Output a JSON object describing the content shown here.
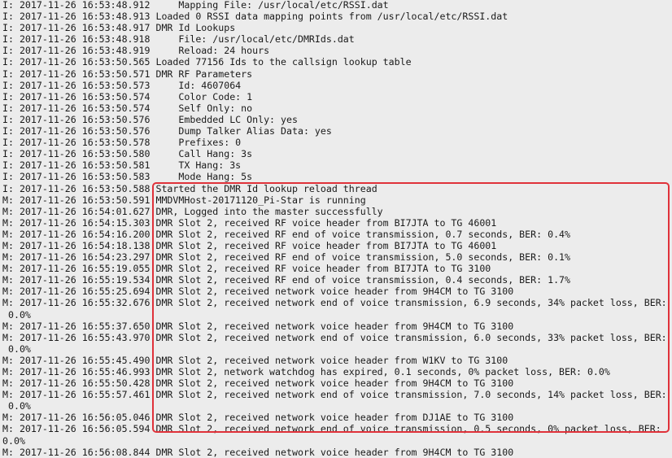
{
  "log_lines": [
    "I: 2017-11-26 16:53:48.912     Mapping File: /usr/local/etc/RSSI.dat",
    "I: 2017-11-26 16:53:48.913 Loaded 0 RSSI data mapping points from /usr/local/etc/RSSI.dat",
    "I: 2017-11-26 16:53:48.917 DMR Id Lookups",
    "I: 2017-11-26 16:53:48.918     File: /usr/local/etc/DMRIds.dat",
    "I: 2017-11-26 16:53:48.919     Reload: 24 hours",
    "I: 2017-11-26 16:53:50.565 Loaded 77156 Ids to the callsign lookup table",
    "I: 2017-11-26 16:53:50.571 DMR RF Parameters",
    "I: 2017-11-26 16:53:50.573     Id: 4607064",
    "I: 2017-11-26 16:53:50.574     Color Code: 1",
    "I: 2017-11-26 16:53:50.574     Self Only: no",
    "I: 2017-11-26 16:53:50.576     Embedded LC Only: yes",
    "I: 2017-11-26 16:53:50.576     Dump Talker Alias Data: yes",
    "I: 2017-11-26 16:53:50.578     Prefixes: 0",
    "I: 2017-11-26 16:53:50.580     Call Hang: 3s",
    "I: 2017-11-26 16:53:50.581     TX Hang: 3s",
    "I: 2017-11-26 16:53:50.583     Mode Hang: 5s",
    "I: 2017-11-26 16:53:50.588 Started the DMR Id lookup reload thread",
    "M: 2017-11-26 16:53:50.591 MMDVMHost-20171120_Pi-Star is running",
    "M: 2017-11-26 16:54:01.627 DMR, Logged into the master successfully",
    "M: 2017-11-26 16:54:15.303 DMR Slot 2, received RF voice header from BI7JTA to TG 46001",
    "M: 2017-11-26 16:54:16.200 DMR Slot 2, received RF end of voice transmission, 0.7 seconds, BER: 0.4%",
    "M: 2017-11-26 16:54:18.138 DMR Slot 2, received RF voice header from BI7JTA to TG 46001",
    "M: 2017-11-26 16:54:23.297 DMR Slot 2, received RF end of voice transmission, 5.0 seconds, BER: 0.1%",
    "M: 2017-11-26 16:55:19.055 DMR Slot 2, received RF voice header from BI7JTA to TG 3100",
    "M: 2017-11-26 16:55:19.534 DMR Slot 2, received RF end of voice transmission, 0.4 seconds, BER: 1.7%",
    "M: 2017-11-26 16:55:25.694 DMR Slot 2, received network voice header from 9H4CM to TG 3100",
    "M: 2017-11-26 16:55:32.676 DMR Slot 2, received network end of voice transmission, 6.9 seconds, 34% packet loss, BER:",
    " 0.0%",
    "M: 2017-11-26 16:55:37.650 DMR Slot 2, received network voice header from 9H4CM to TG 3100",
    "M: 2017-11-26 16:55:43.970 DMR Slot 2, received network end of voice transmission, 6.0 seconds, 33% packet loss, BER:",
    " 0.0%",
    "M: 2017-11-26 16:55:45.490 DMR Slot 2, received network voice header from W1KV to TG 3100",
    "M: 2017-11-26 16:55:46.993 DMR Slot 2, network watchdog has expired, 0.1 seconds, 0% packet loss, BER: 0.0%",
    "M: 2017-11-26 16:55:50.428 DMR Slot 2, received network voice header from 9H4CM to TG 3100",
    "M: 2017-11-26 16:55:57.461 DMR Slot 2, received network end of voice transmission, 7.0 seconds, 14% packet loss, BER:",
    " 0.0%",
    "M: 2017-11-26 16:56:05.046 DMR Slot 2, received network voice header from DJ1AE to TG 3100",
    "M: 2017-11-26 16:56:05.594 DMR Slot 2, received network end of voice transmission, 0.5 seconds, 0% packet loss, BER:",
    "0.0%",
    "M: 2017-11-26 16:56:08.844 DMR Slot 2, received network voice header from 9H4CM to TG 3100"
  ],
  "highlight_color": "#e0323a"
}
